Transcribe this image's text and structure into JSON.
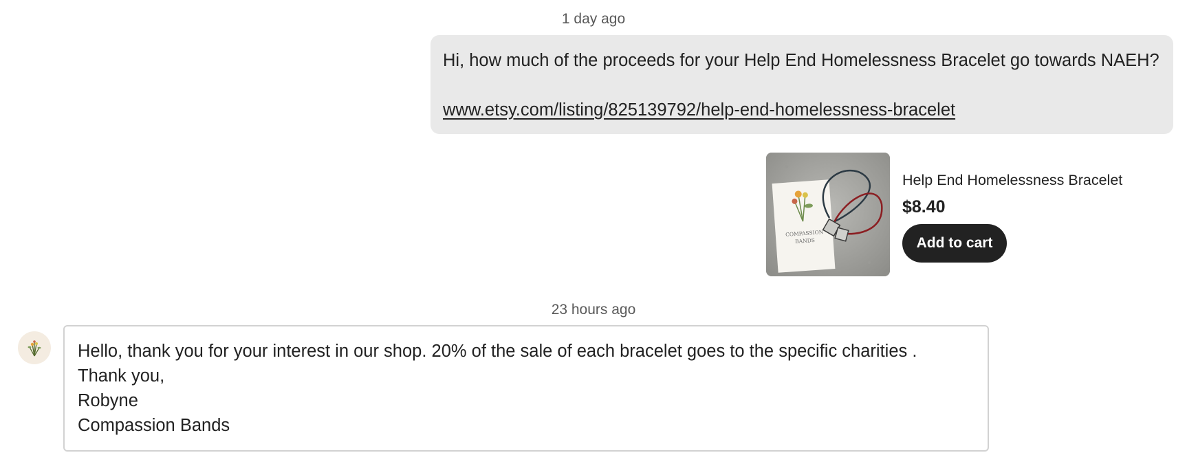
{
  "thread": {
    "outgoing": {
      "timestamp": "1 day ago",
      "text": "Hi, how much of the proceeds for your Help End Homelessness Bracelet go towards NAEH?",
      "link": "www.etsy.com/listing/825139792/help-end-homelessness-bracelet"
    },
    "listing": {
      "title": "Help End Homelessness Bracelet",
      "price": "$8.40",
      "add_to_cart_label": "Add to cart",
      "image_card_text_line1": "COMPASSION",
      "image_card_text_line2": "BANDS"
    },
    "incoming": {
      "timestamp": "23 hours ago",
      "lines": [
        "Hello, thank you for your interest in our shop. 20% of the sale of each bracelet goes to the specific charities .",
        "Thank you,",
        "Robyne",
        "Compassion Bands"
      ]
    }
  },
  "colors": {
    "outgoing_bubble": "#e9e9e9",
    "button_bg": "#222222",
    "avatar_bg": "#f4ece1",
    "incoming_border": "#d2d2d2"
  },
  "icons": {
    "avatar": "flower-bouquet-icon"
  }
}
